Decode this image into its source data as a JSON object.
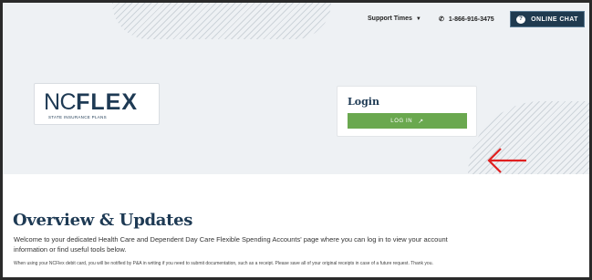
{
  "topbar": {
    "support_label": "Support Times",
    "support_caret": "▼",
    "phone_icon": "phone-icon",
    "phone_number": "1-866-916-3475",
    "chat_icon": "chat-bubble-icon",
    "chat_label": "ONLINE CHAT"
  },
  "logo": {
    "nc": "NC",
    "flex": "FLEX",
    "subtitle": "STATE INSURANCE PLANS"
  },
  "login": {
    "title": "Login",
    "button_label": "LOG IN",
    "button_icon": "external-link-icon"
  },
  "overview": {
    "title": "Overview & Updates",
    "intro": "Welcome to your dedicated Health Care and Dependent Day Care Flexible Spending Accounts' page where you can log in to view your account information or find useful tools below.",
    "note": "When using your NCFlex debit card, you will be notified by P&A in writing if you need to submit documentation, such as a receipt. Please save all of your original receipts in case of a future request. Thank you."
  },
  "colors": {
    "navy": "#1e3a54",
    "chat_bg": "#1f3a4f",
    "login_green": "#6aa84f",
    "annotation_red": "#e02020",
    "hero_bg": "#eef1f4"
  }
}
